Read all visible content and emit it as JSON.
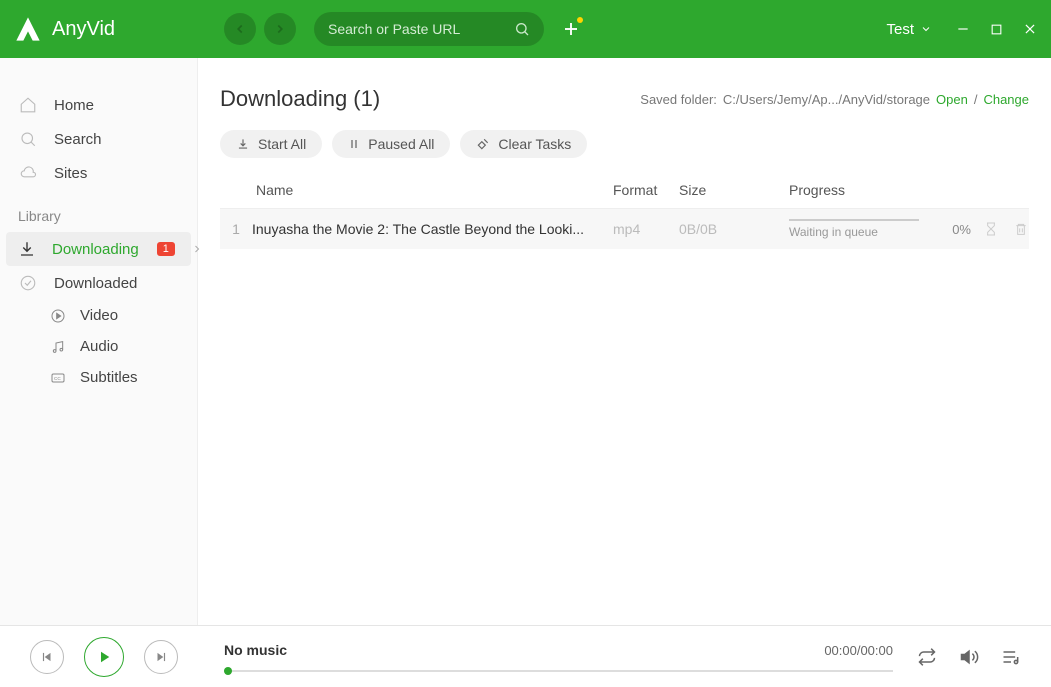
{
  "header": {
    "app_name": "AnyVid",
    "search_placeholder": "Search or Paste URL",
    "user_label": "Test"
  },
  "sidebar": {
    "nav": [
      "Home",
      "Search",
      "Sites"
    ],
    "section": "Library",
    "lib": {
      "downloading": "Downloading",
      "downloading_badge": "1",
      "downloaded": "Downloaded",
      "sub": [
        "Video",
        "Audio",
        "Subtitles"
      ]
    }
  },
  "main": {
    "title": "Downloading (1)",
    "folder_label": "Saved folder:",
    "folder_path": "C:/Users/Jemy/Ap.../AnyVid/storage",
    "open": "Open",
    "sep": "/",
    "change": "Change",
    "toolbar": {
      "start": "Start All",
      "paused": "Paused All",
      "clear": "Clear Tasks"
    },
    "columns": {
      "name": "Name",
      "format": "Format",
      "size": "Size",
      "progress": "Progress"
    },
    "rows": [
      {
        "idx": "1",
        "name": "Inuyasha the Movie 2: The Castle Beyond the Looki...",
        "format": "mp4",
        "size": "0B/0B",
        "status": "Waiting in queue",
        "pct": "0%"
      }
    ]
  },
  "player": {
    "title": "No music",
    "time": "00:00/00:00"
  }
}
